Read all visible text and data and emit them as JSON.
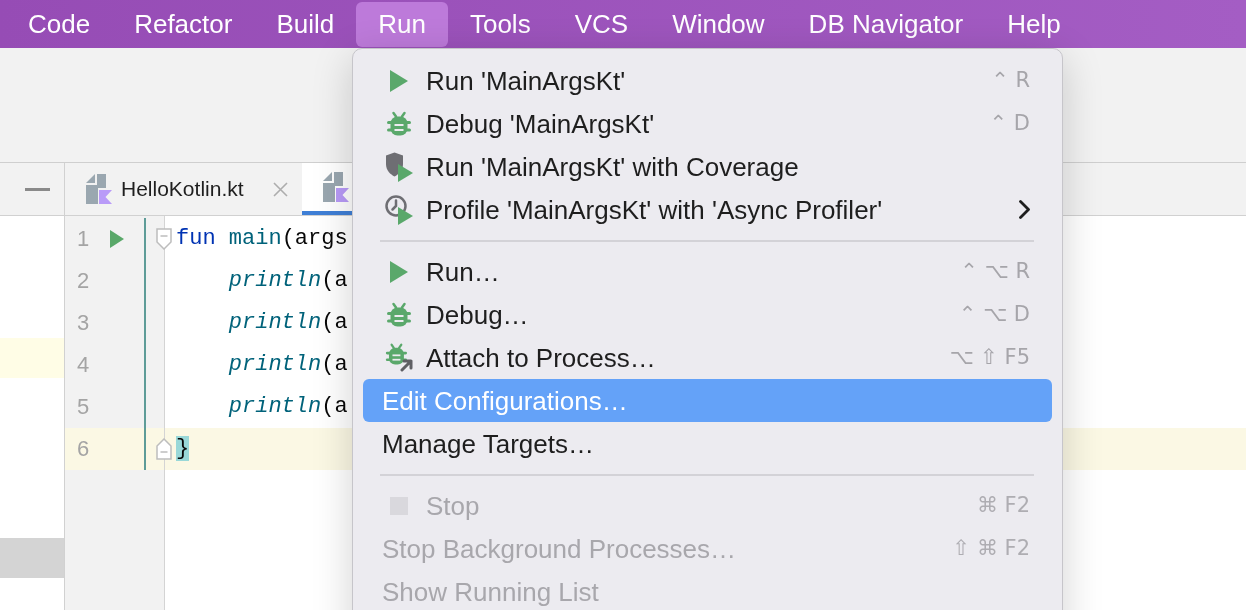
{
  "menu_bar": [
    {
      "label": "Code",
      "selected": false
    },
    {
      "label": "Refactor",
      "selected": false
    },
    {
      "label": "Build",
      "selected": false
    },
    {
      "label": "Run",
      "selected": true
    },
    {
      "label": "Tools",
      "selected": false
    },
    {
      "label": "VCS",
      "selected": false
    },
    {
      "label": "Window",
      "selected": false
    },
    {
      "label": "DB Navigator",
      "selected": false
    },
    {
      "label": "Help",
      "selected": false
    }
  ],
  "editor_tabs": [
    {
      "label": "HelloKotlin.kt",
      "selected": false,
      "closable": true
    },
    {
      "selected": true
    }
  ],
  "editor": {
    "lines": [
      {
        "number": "1",
        "kind": "block-start",
        "run_marker": true,
        "current": false,
        "tokens": [
          {
            "kind": "keyword",
            "text": "fun"
          },
          {
            "kind": "function",
            "text": "main"
          },
          {
            "kind": "plain",
            "text": "(args"
          }
        ],
        "children": [
          {
            "number": "2",
            "run_marker": false,
            "current": false,
            "tokens": [
              {
                "kind": "call",
                "text": "println"
              },
              {
                "kind": "plain",
                "text": "(a"
              }
            ]
          },
          {
            "number": "3",
            "run_marker": false,
            "current": false,
            "tokens": [
              {
                "kind": "call",
                "text": "println"
              },
              {
                "kind": "plain",
                "text": "(a"
              }
            ]
          },
          {
            "number": "4",
            "run_marker": false,
            "current": false,
            "tokens": [
              {
                "kind": "call",
                "text": "println"
              },
              {
                "kind": "plain",
                "text": "(a"
              }
            ]
          },
          {
            "number": "5",
            "run_marker": false,
            "current": false,
            "tokens": [
              {
                "kind": "call",
                "text": "println"
              },
              {
                "kind": "plain",
                "text": "(a"
              }
            ]
          }
        ]
      },
      {
        "number": "6",
        "kind": "block-end",
        "run_marker": false,
        "current": true,
        "tokens": [
          {
            "kind": "brace",
            "text": "}"
          }
        ]
      }
    ]
  },
  "run_menu": {
    "groups": [
      {
        "items": [
          {
            "kind": "run",
            "label": "Run 'MainArgsKt'",
            "shortcut": "⌃ R",
            "selected": false,
            "disabled": false,
            "submenu": false
          },
          {
            "kind": "debug",
            "label": "Debug 'MainArgsKt'",
            "shortcut": "⌃ D",
            "selected": false,
            "disabled": false,
            "submenu": false
          },
          {
            "kind": "coverage",
            "label": "Run 'MainArgsKt' with Coverage",
            "selected": false,
            "disabled": false,
            "submenu": false
          },
          {
            "kind": "profile",
            "label": "Profile 'MainArgsKt' with 'Async Profiler'",
            "selected": false,
            "disabled": false,
            "submenu": true
          }
        ]
      },
      {
        "items": [
          {
            "kind": "run",
            "label": "Run…",
            "shortcut": "⌃ ⌥ R",
            "selected": false,
            "disabled": false,
            "submenu": false
          },
          {
            "kind": "debug",
            "label": "Debug…",
            "shortcut": "⌃ ⌥ D",
            "selected": false,
            "disabled": false,
            "submenu": false
          },
          {
            "kind": "attach",
            "label": "Attach to Process…",
            "shortcut": "⌥ ⇧ F5",
            "selected": false,
            "disabled": false,
            "submenu": false
          },
          {
            "kind": "plain",
            "label": "Edit Configurations…",
            "selected": true,
            "disabled": false,
            "submenu": false
          },
          {
            "kind": "plain",
            "label": "Manage Targets…",
            "selected": false,
            "disabled": false,
            "submenu": false
          }
        ]
      },
      {
        "items": [
          {
            "kind": "stop",
            "label": "Stop",
            "shortcut": "⌘ F2",
            "selected": false,
            "disabled": true,
            "submenu": false
          },
          {
            "kind": "plain",
            "label": "Stop Background Processes…",
            "shortcut": "⇧ ⌘ F2",
            "selected": false,
            "disabled": true,
            "submenu": false
          },
          {
            "kind": "plain",
            "label": "Show Running List",
            "selected": false,
            "disabled": true,
            "submenu": false
          }
        ]
      }
    ]
  }
}
